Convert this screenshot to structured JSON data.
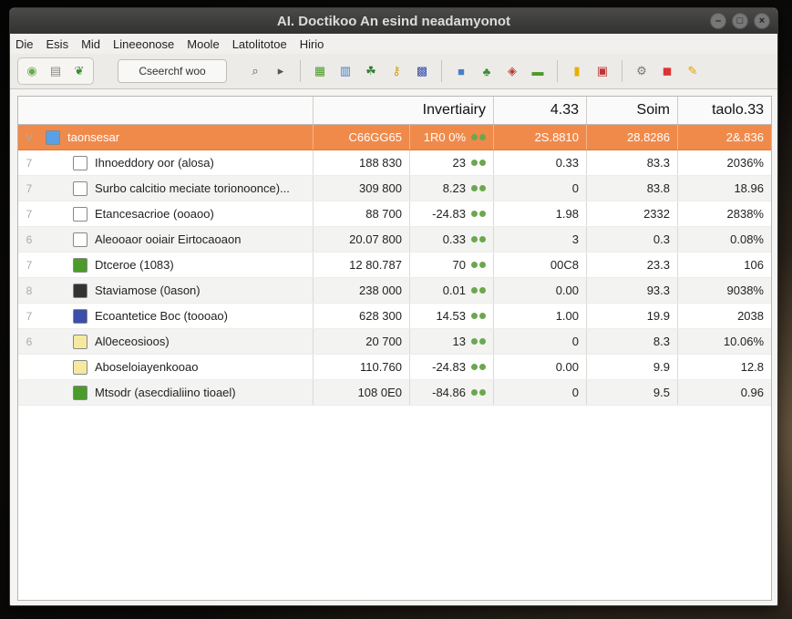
{
  "window": {
    "title": "AI. Doctikoo An esind neadamyonot"
  },
  "menu": [
    "Die",
    "Esis",
    "Mid",
    "Lineeonose",
    "Moole",
    "Latolitotoe",
    "Hirio"
  ],
  "toolbar": {
    "combo_value": "Cseerchf woo",
    "buttons": [
      {
        "name": "nav-back-icon",
        "glyph": "◉",
        "color": "#6aa84f"
      },
      {
        "name": "print-icon",
        "glyph": "▤",
        "color": "#888"
      },
      {
        "name": "leaf-icon",
        "glyph": "❦",
        "color": "#3c8c2e"
      },
      {
        "name": "search-icon",
        "glyph": "⌕",
        "color": "#555"
      },
      {
        "name": "play-icon",
        "glyph": "▸",
        "color": "#555"
      },
      {
        "name": "calendar-icon",
        "glyph": "▦",
        "color": "#4c9a2a"
      },
      {
        "name": "chart-icon",
        "glyph": "▥",
        "color": "#3d7fc6"
      },
      {
        "name": "people-icon",
        "glyph": "☘",
        "color": "#2e7d32"
      },
      {
        "name": "key-icon",
        "glyph": "⚷",
        "color": "#d4a017"
      },
      {
        "name": "grid-icon",
        "glyph": "▩",
        "color": "#3b4fa8"
      },
      {
        "name": "folder-blue-icon",
        "glyph": "■",
        "color": "#4a7ec9"
      },
      {
        "name": "plant-icon",
        "glyph": "♣",
        "color": "#3c8c2e"
      },
      {
        "name": "palette-icon",
        "glyph": "◈",
        "color": "#c0392b"
      },
      {
        "name": "money-icon",
        "glyph": "▬",
        "color": "#4c9a2a"
      },
      {
        "name": "note-icon",
        "glyph": "▮",
        "color": "#e5b000"
      },
      {
        "name": "film-icon",
        "glyph": "▣",
        "color": "#b33"
      },
      {
        "name": "settings-icon",
        "glyph": "⚙",
        "color": "#777"
      },
      {
        "name": "stop-icon",
        "glyph": "◼",
        "color": "#d33"
      },
      {
        "name": "brush-icon",
        "glyph": "✎",
        "color": "#e3a000"
      }
    ]
  },
  "table": {
    "headers": [
      "",
      "Invertiairy",
      "4.33",
      "Soim",
      "taolo.33"
    ],
    "rows": [
      {
        "lvl": "V",
        "name": "taonsesar",
        "v1": "C66GG65",
        "v2": "1R0 0%",
        "v3": "2S.8810",
        "v4": "28.8286",
        "v5": "2&.836",
        "sel": true,
        "icon": "#5aa0e6"
      },
      {
        "lvl": "7",
        "name": "Ihnoeddory oor (alosa)",
        "v1": "188 830",
        "v2": "23",
        "v3": "0.33",
        "v4": "83.3",
        "v5": "2036%",
        "icon": "#fff"
      },
      {
        "lvl": "7",
        "name": "Surbo calcitio meciate torionoonce)...",
        "v1": "309 800",
        "v2": "8.23",
        "v3": "0",
        "v4": "83.8",
        "v5": "18.96",
        "icon": "#fff"
      },
      {
        "lvl": "7",
        "name": "Etancesacrioe (ooaoo)",
        "v1": "88 700",
        "v2": "-24.83",
        "v3": "1.98",
        "v4": "2332",
        "v5": "2838%",
        "icon": "#fff"
      },
      {
        "lvl": "6",
        "name": "Aleooaor ooiair Eirtocaoaon",
        "v1": "20.07 800",
        "v2": "0.33",
        "v3": "3",
        "v4": "0.3",
        "v5": "0.08%",
        "icon": "#fff"
      },
      {
        "lvl": "7",
        "name": "Dtceroe (1083)",
        "v1": "12 80.787",
        "v2": "70",
        "v3": "00C8",
        "v4": "23.3",
        "v5": "106",
        "icon": "#4c9a2a"
      },
      {
        "lvl": "8",
        "name": "Staviamose (0ason)",
        "v1": "238 000",
        "v2": "0.01",
        "v3": "0.00",
        "v4": "93.3",
        "v5": "9038%",
        "icon": "#333"
      },
      {
        "lvl": "7",
        "name": "Ecoantetice Boc (toooao)",
        "v1": "628 300",
        "v2": "14.53",
        "v3": "1.00",
        "v4": "19.9",
        "v5": "2038",
        "icon": "#3b4fa8"
      },
      {
        "lvl": "6",
        "name": "Al0eceosioos)",
        "v1": "20 700",
        "v2": "13",
        "v3": "0",
        "v4": "8.3",
        "v5": "10.06%",
        "icon": "#f5e9a0"
      },
      {
        "lvl": "",
        "name": "Aboseloiayenkooao",
        "v1": "110.760",
        "v2": "-24.83",
        "v3": "0.00",
        "v4": "9.9",
        "v5": "12.8",
        "icon": "#f5e9a0"
      },
      {
        "lvl": "",
        "name": "Mtsodr (asecdialiino tioael)",
        "v1": "108 0E0",
        "v2": "-84.86",
        "v3": "0",
        "v4": "9.5",
        "v5": "0.96",
        "icon": "#4c9a2a"
      }
    ]
  }
}
